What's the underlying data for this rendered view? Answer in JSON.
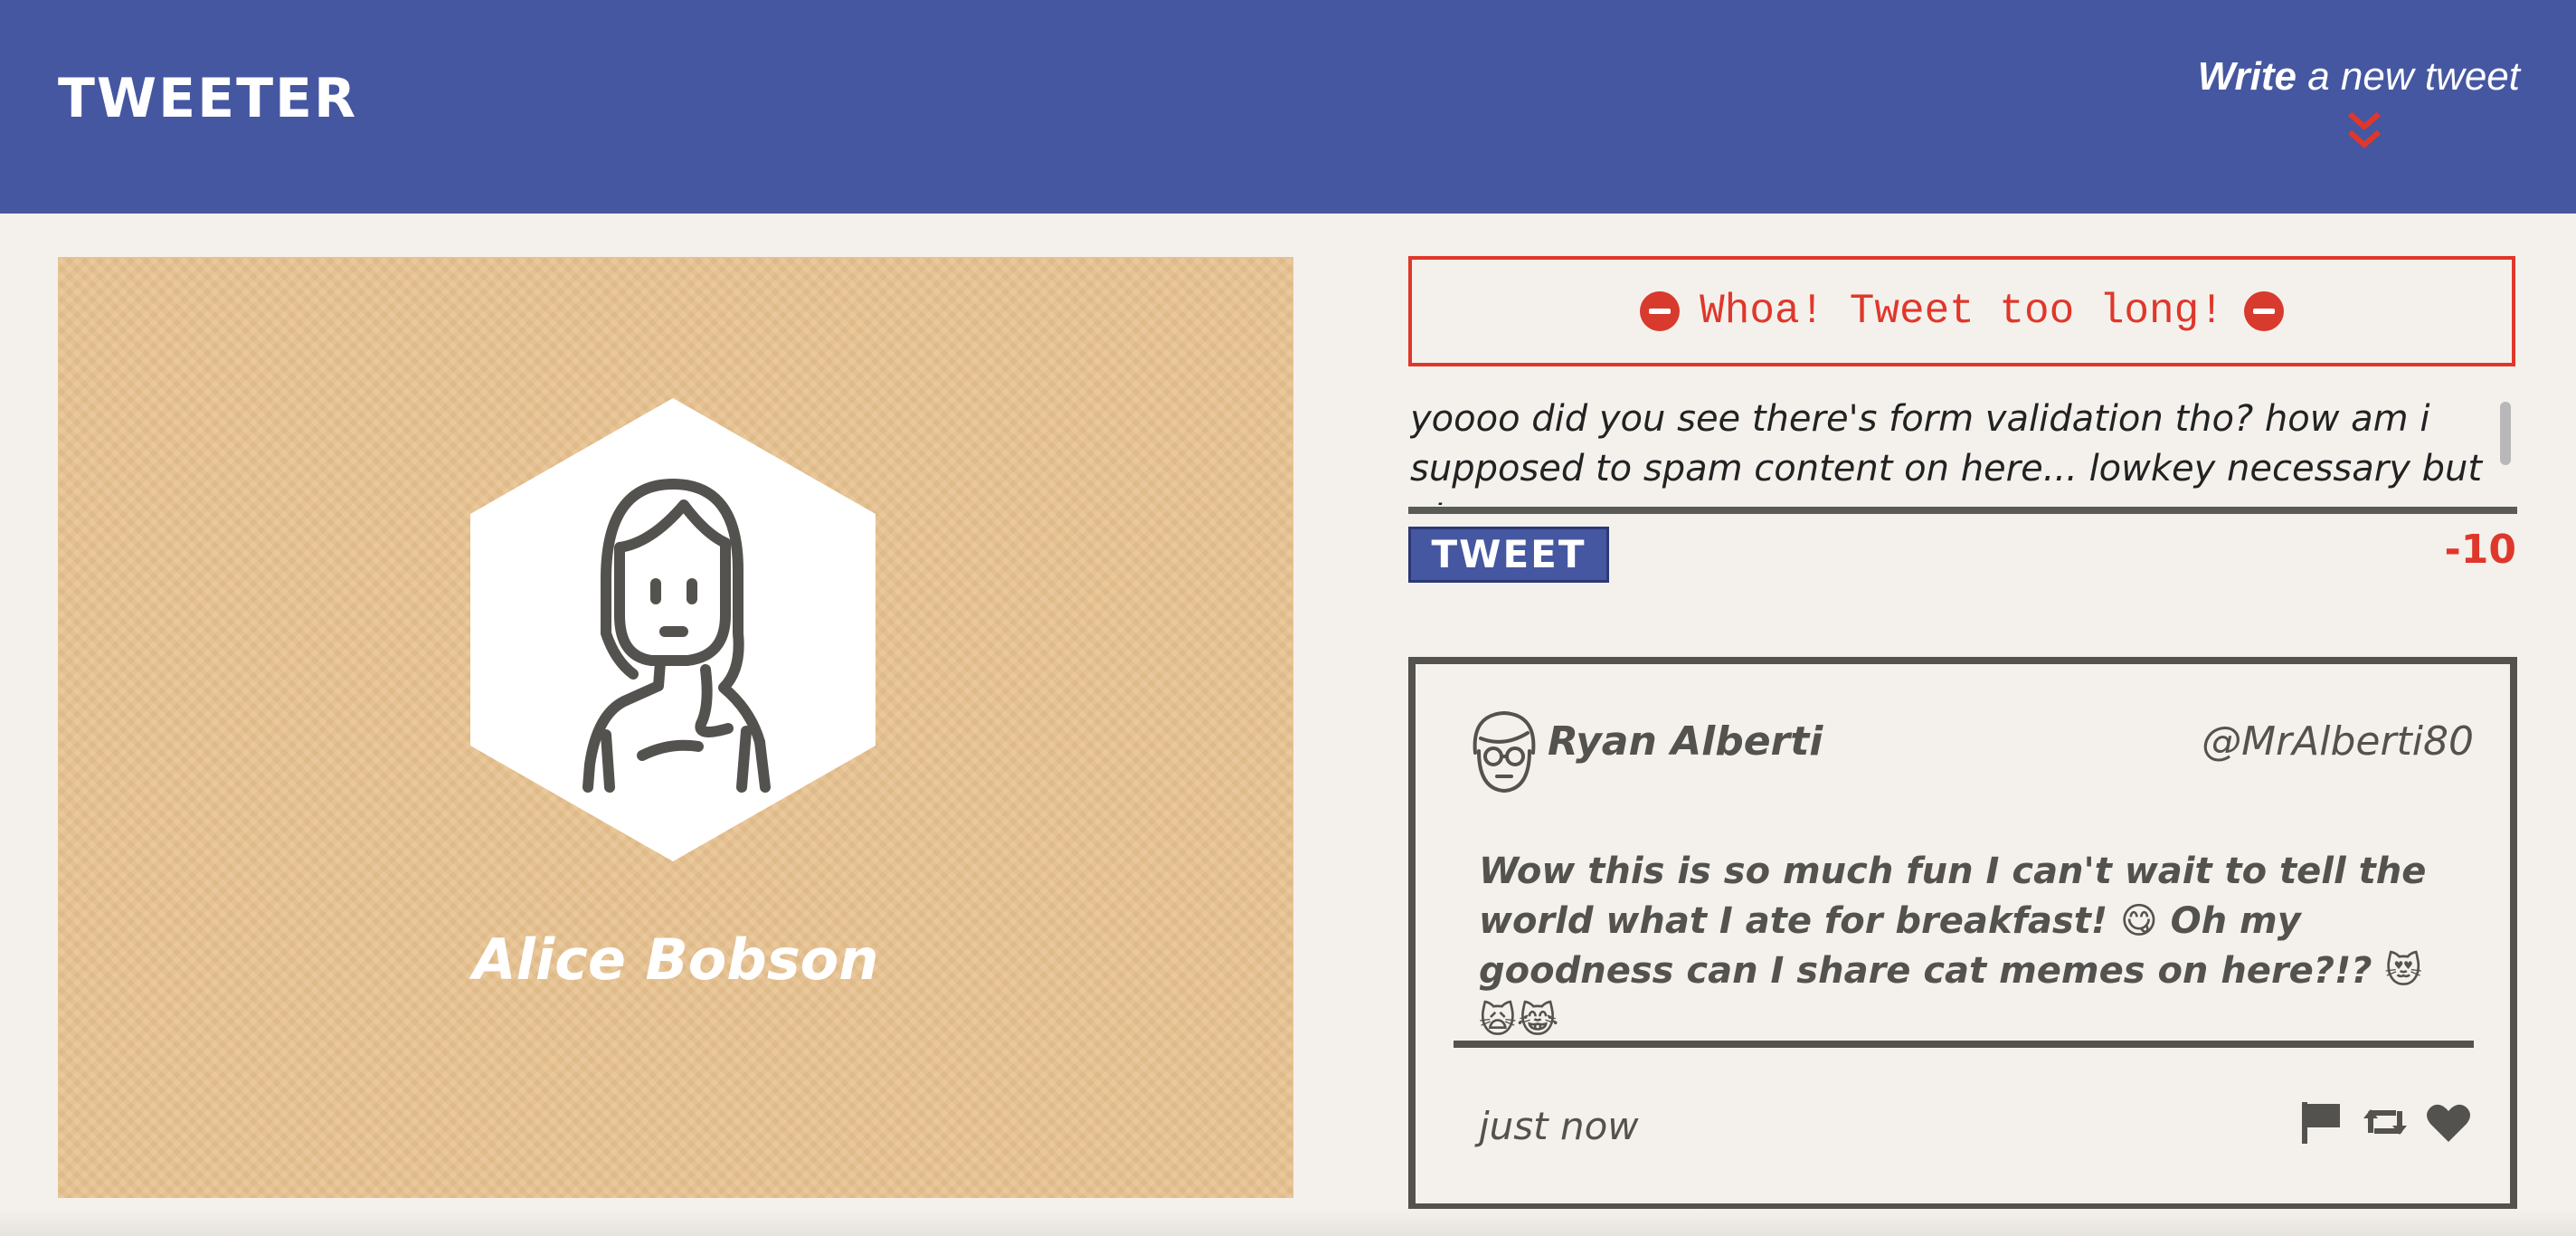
{
  "nav": {
    "brand": "TWEETER",
    "compose_strong": "Write",
    "compose_rest": " a new tweet"
  },
  "profile": {
    "name": "Alice Bobson"
  },
  "compose": {
    "error_message": "Whoa! Tweet too long!",
    "text": "yoooo did you see there's form validation tho? how am i supposed to spam content on here... lowkey necessary but also",
    "button_label": "TWEET",
    "counter": "-10"
  },
  "tweet": {
    "name": "Ryan Alberti",
    "handle": "@MrAlberti80",
    "body": "Wow this is so much fun I can't wait to tell the world what I ate for breakfast! 😋 Oh my goodness can I share cat memes on here?!? 😻🙀😹",
    "time": "just now",
    "actions": [
      "flag-icon",
      "retweet-icon",
      "heart-icon"
    ]
  },
  "colors": {
    "nav": "#4557a0",
    "accent_red": "#e0372b",
    "ink": "#54524e",
    "profile_bg": "#e8c28f",
    "page_bg": "#f4f1ec"
  }
}
